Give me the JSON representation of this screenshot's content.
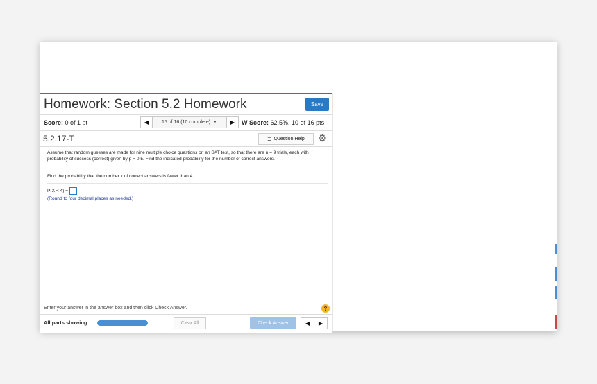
{
  "homework": {
    "title": "Homework: Section 5.2 Homework",
    "save_label": "Save"
  },
  "score_bar": {
    "score_label": "Score:",
    "score_value": "0 of 1 pt",
    "nav_text": "15 of 16 (10 complete)",
    "hw_score_label": "W Score:",
    "hw_score_value": "62.5%, 10 of 16 pts"
  },
  "question": {
    "id": "5.2.17-T",
    "help_label": "Question Help",
    "prompt": "Assume that random guesses are made for nine multiple choice questions on an SAT test, so that there are n = 9 trials, each with probability of success (correct) given by p = 0.5. Find the indicated probability for the number of correct answers.",
    "find_text": "Find the probability that the number x of correct answers is fewer than 4.",
    "expression": "P(X < 4) =",
    "answer_value": "",
    "round_note": "(Round to four decimal places as needed.)"
  },
  "footer": {
    "instruction": "Enter your answer in the answer box and then click Check Answer.",
    "help_icon": "?",
    "parts_label": "All parts showing",
    "progress_fraction": 1.0,
    "clear_label": "Clear All",
    "check_label": "Check Answer"
  },
  "icons": {
    "prev": "◀",
    "next": "▶",
    "dropdown": "▼",
    "list": "☰",
    "gear": "⚙"
  },
  "colors": {
    "accent": "#2b79c2",
    "check_disabled": "#9fc2e6",
    "help_icon": "#f0b52b",
    "round_note": "#1a3a9c"
  }
}
